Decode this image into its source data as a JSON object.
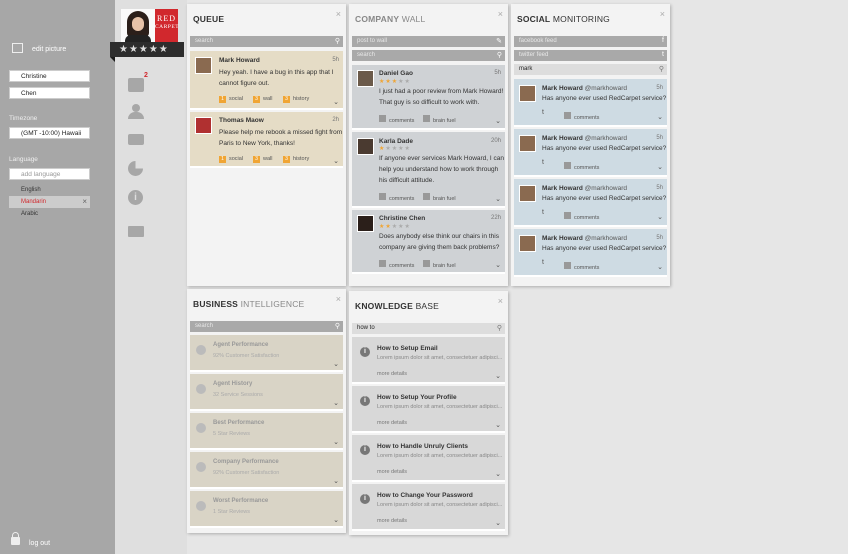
{
  "colors": {
    "accent": "#f0a534",
    "brand_red": "#d1282d",
    "queue_card": "#e5dcc6",
    "social_card": "#cedbe3"
  },
  "sidebar": {
    "edit_picture": "edit picture",
    "first_name": "Christine",
    "last_name": "Chen",
    "timezone_label": "Timezone",
    "timezone_value": "(GMT -10:00) Hawaii",
    "language_label": "Language",
    "add_language_placeholder": "add language",
    "languages": [
      "English",
      "Mandarin",
      "Arabic"
    ],
    "logout": "log out",
    "logo_line1": "RED",
    "logo_line2": "CARPET",
    "inbox_badge": "2"
  },
  "queue": {
    "title_bold": "QUEUE",
    "title_light": "",
    "search_placeholder": "search",
    "items": [
      {
        "name": "Mark Howard",
        "time": "5h",
        "msg1": "Hey yeah. I have a bug in this app that I",
        "msg2": "cannot figure out.",
        "social": "1",
        "social_label": "social",
        "wall": "3",
        "wall_label": "wall",
        "history": "3",
        "history_label": "history"
      },
      {
        "name": "Thomas Maow",
        "time": "2h",
        "msg1": "Please help me rebook a missed fight from",
        "msg2": "Paris to New York, thanks!",
        "social": "1",
        "social_label": "social",
        "wall": "3",
        "wall_label": "wall",
        "history": "3",
        "history_label": "history"
      }
    ]
  },
  "company_wall": {
    "title_bold": "COMPANY",
    "title_light": "WALL",
    "post_placeholder": "post to wall",
    "search_placeholder": "search",
    "items": [
      {
        "name": "Daniel Gao",
        "time": "5h",
        "rating": 3,
        "msg1": "I just had a poor review from Mark Howard!",
        "msg2": "That guy is so difficult to work with.",
        "msg3": "",
        "comments": "comments",
        "brain": "brain fuel"
      },
      {
        "name": "Karla Dade",
        "time": "20h",
        "rating": 1,
        "msg1": "If anyone ever services Mark Howard, I can",
        "msg2": "help you understand how to work through",
        "msg3": "his difficult attitude.",
        "comments": "comments",
        "brain": "brain fuel"
      },
      {
        "name": "Christine Chen",
        "time": "22h",
        "rating": 2,
        "msg1": "Does anybody else think our chairs in this",
        "msg2": "company are giving them back problems?",
        "msg3": "",
        "comments": "comments",
        "brain": "brain fuel"
      }
    ]
  },
  "social": {
    "title_bold": "SOCIAL",
    "title_light": "MONITORING",
    "facebook_feed": "facebook feed",
    "twitter_feed": "twitter feed",
    "search_value": "mark",
    "items": [
      {
        "name": "Mark Howard",
        "handle": "@markhoward",
        "time": "5h",
        "msg": "Has anyone ever used RedCarpet service?",
        "comments": "comments"
      },
      {
        "name": "Mark Howard",
        "handle": "@markhoward",
        "time": "5h",
        "msg": "Has anyone ever used RedCarpet service?",
        "comments": "comments"
      },
      {
        "name": "Mark Howard",
        "handle": "@markhoward",
        "time": "5h",
        "msg": "Has anyone ever used RedCarpet service?",
        "comments": "comments"
      },
      {
        "name": "Mark Howard",
        "handle": "@markhoward",
        "time": "5h",
        "msg": "Has anyone ever used RedCarpet service?",
        "comments": "comments"
      }
    ]
  },
  "bi": {
    "title_bold": "BUSINESS",
    "title_light": "INTELLIGENCE",
    "search_placeholder": "search",
    "items": [
      {
        "title": "Agent Performance",
        "sub": "92% Customer Satisfaction"
      },
      {
        "title": "Agent History",
        "sub": "32 Service Sessions"
      },
      {
        "title": "Best Performance",
        "sub": "5 Star Reviews"
      },
      {
        "title": "Company Performance",
        "sub": "92% Customer Satisfaction"
      },
      {
        "title": "Worst Performance",
        "sub": "1 Star Reviews"
      }
    ]
  },
  "kb": {
    "title_bold": "KNOWLEDGE",
    "title_light": "BASE",
    "search_value": "how to",
    "items": [
      {
        "title": "How to Setup Email",
        "sub": "Lorem ipsum dolor sit amet, consectetuer adipisci...",
        "more": "more details"
      },
      {
        "title": "How to Setup Your Profile",
        "sub": "Lorem ipsum dolor sit amet, consectetuer adipisci...",
        "more": "more details"
      },
      {
        "title": "How to Handle Unruly Clients",
        "sub": "Lorem ipsum dolor sit amet, consectetuer adipisci...",
        "more": "more details"
      },
      {
        "title": "How to Change Your Password",
        "sub": "Lorem ipsum dolor sit amet, consectetuer adipisci...",
        "more": "more details"
      }
    ]
  }
}
